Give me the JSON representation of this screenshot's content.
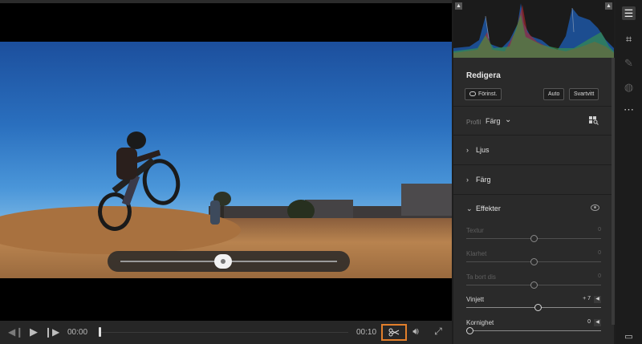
{
  "player": {
    "current_time": "00:00",
    "end_time": "00:10",
    "trim_icon": "scissors-trim-icon",
    "volume_icon": "volume-icon",
    "fullscreen_icon": "expand-icon"
  },
  "panel": {
    "title": "Redigera",
    "presets_label": "Förinst.",
    "auto_label": "Auto",
    "bw_label": "Svartvitt",
    "profile_label": "Profil",
    "profile_value": "Färg",
    "sections": [
      {
        "label": "Ljus",
        "expanded": false
      },
      {
        "label": "Färg",
        "expanded": false
      },
      {
        "label": "Effekter",
        "expanded": true
      }
    ],
    "sliders": [
      {
        "label": "Textur",
        "value": "0",
        "enabled": false,
        "level": 0.5
      },
      {
        "label": "Klarhet",
        "value": "0",
        "enabled": false,
        "level": 0.5
      },
      {
        "label": "Ta bort dis",
        "value": "0",
        "enabled": false,
        "level": 0.5
      },
      {
        "label": "Vinjett",
        "value": "+ 7",
        "enabled": true,
        "level": 0.535
      },
      {
        "label": "Kornighet",
        "value": "0",
        "enabled": true,
        "level": 0.0
      }
    ]
  },
  "colors": {
    "accent_trim": "#e27f2b",
    "panel_bg": "#2a2a2a"
  }
}
